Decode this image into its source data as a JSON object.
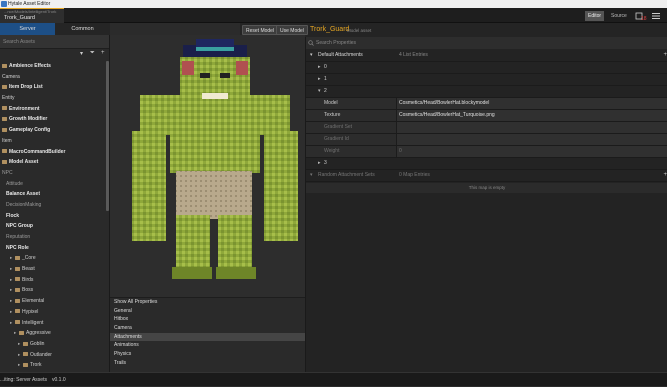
{
  "window": {
    "title": "Hytale Asset Editor"
  },
  "asset_tab": {
    "path": "...nce/Models/Intelligent/Trork",
    "name": "Trork_Guard"
  },
  "left_tabs": [
    {
      "label": "Server",
      "active": true
    },
    {
      "label": "Common",
      "active": false
    }
  ],
  "toolbar": {
    "reset_model": "Reset Model",
    "use_model": "Use Model"
  },
  "model_header": {
    "title": "Trork_Guard",
    "subtitle": "Model asset"
  },
  "view_toggle": {
    "editor": "Editor",
    "source": "Source"
  },
  "sidebar": {
    "search_placeholder": "Search Assets",
    "tree": [
      {
        "label": "Ambience Effects",
        "style": "bold",
        "icon": "folder",
        "indent": 0
      },
      {
        "label": "Camera",
        "style": "normal",
        "icon": "none",
        "indent": 0
      },
      {
        "label": "Item Drop List",
        "style": "bold",
        "icon": "folder",
        "indent": 0
      },
      {
        "label": "Entity",
        "style": "normal",
        "icon": "none",
        "indent": 0
      },
      {
        "label": "Environment",
        "style": "bold",
        "icon": "folder",
        "indent": 0
      },
      {
        "label": "Growth Modifier",
        "style": "bold",
        "icon": "folder",
        "indent": 0
      },
      {
        "label": "Gameplay Config",
        "style": "bold",
        "icon": "folder",
        "indent": 0
      },
      {
        "label": "Item",
        "style": "normal",
        "icon": "none",
        "indent": 0
      },
      {
        "label": "MacroCommandBuilder",
        "style": "bold",
        "icon": "folder",
        "indent": 0
      },
      {
        "label": "Model Asset",
        "style": "bold",
        "icon": "folder",
        "indent": 0
      },
      {
        "label": "NPC",
        "style": "dim",
        "icon": "none",
        "indent": 0
      },
      {
        "label": "Attitude",
        "style": "dim",
        "icon": "none",
        "indent": 1
      },
      {
        "label": "Balance Asset",
        "style": "bold",
        "icon": "none",
        "indent": 1
      },
      {
        "label": "DecisionMaking",
        "style": "dim",
        "icon": "none",
        "indent": 1
      },
      {
        "label": "Flock",
        "style": "bold",
        "icon": "none",
        "indent": 1
      },
      {
        "label": "NPC Group",
        "style": "bold",
        "icon": "none",
        "indent": 1
      },
      {
        "label": "Reputation",
        "style": "dim",
        "icon": "none",
        "indent": 1
      },
      {
        "label": "NPC Role",
        "style": "bold",
        "icon": "none",
        "indent": 1
      },
      {
        "label": "_Core",
        "style": "normal",
        "icon": "folder",
        "indent": 2
      },
      {
        "label": "Beast",
        "style": "normal",
        "icon": "folder",
        "indent": 2
      },
      {
        "label": "Birds",
        "style": "normal",
        "icon": "folder",
        "indent": 2
      },
      {
        "label": "Boss",
        "style": "normal",
        "icon": "folder",
        "indent": 2
      },
      {
        "label": "Elemental",
        "style": "normal",
        "icon": "folder",
        "indent": 2
      },
      {
        "label": "Hypixel",
        "style": "normal",
        "icon": "folder",
        "indent": 2
      },
      {
        "label": "Intelligent",
        "style": "normal",
        "icon": "folder",
        "indent": 2
      },
      {
        "label": "Aggressive",
        "style": "normal",
        "icon": "folder",
        "indent": 3
      },
      {
        "label": "Goblin",
        "style": "normal",
        "icon": "folder",
        "indent": 4
      },
      {
        "label": "Outlander",
        "style": "normal",
        "icon": "folder",
        "indent": 4
      },
      {
        "label": "Trork",
        "style": "normal",
        "icon": "folder",
        "indent": 4
      }
    ]
  },
  "properties_menu": {
    "items": [
      {
        "label": "Show All Properties",
        "selected": false
      },
      {
        "label": "General",
        "selected": false
      },
      {
        "label": "Hitbox",
        "selected": false
      },
      {
        "label": "Camera",
        "selected": false
      },
      {
        "label": "Attachments",
        "selected": true
      },
      {
        "label": "Animations",
        "selected": false
      },
      {
        "label": "Physics",
        "selected": false
      },
      {
        "label": "Trails",
        "selected": false
      }
    ]
  },
  "right_panel": {
    "search_placeholder": "Search Properties",
    "default_attachments": {
      "label": "Default Attachments",
      "count": "4 List Entries"
    },
    "entries": [
      "0",
      "1",
      "2",
      "3"
    ],
    "entry2_props": [
      {
        "label": "Model",
        "value": "Cosmetics/Head/BowlerHat.blockymodel"
      },
      {
        "label": "Texture",
        "value": "Cosmetics/Head/BowlerHat_Turquoise.png"
      },
      {
        "label": "Gradient Set",
        "value": ""
      },
      {
        "label": "Gradient Id",
        "value": ""
      },
      {
        "label": "Weight",
        "value": "0"
      }
    ],
    "random_attachments": {
      "label": "Random Attachment Sets",
      "count": "0 Map Entries"
    },
    "empty_message": "This map is empty"
  },
  "status_bar": {
    "connection": "...iting: Server Assets",
    "version": "v0.1.0"
  },
  "colors": {
    "accent": "#e5a623",
    "selected_tab": "#1d4f86",
    "panel": "#232323"
  }
}
